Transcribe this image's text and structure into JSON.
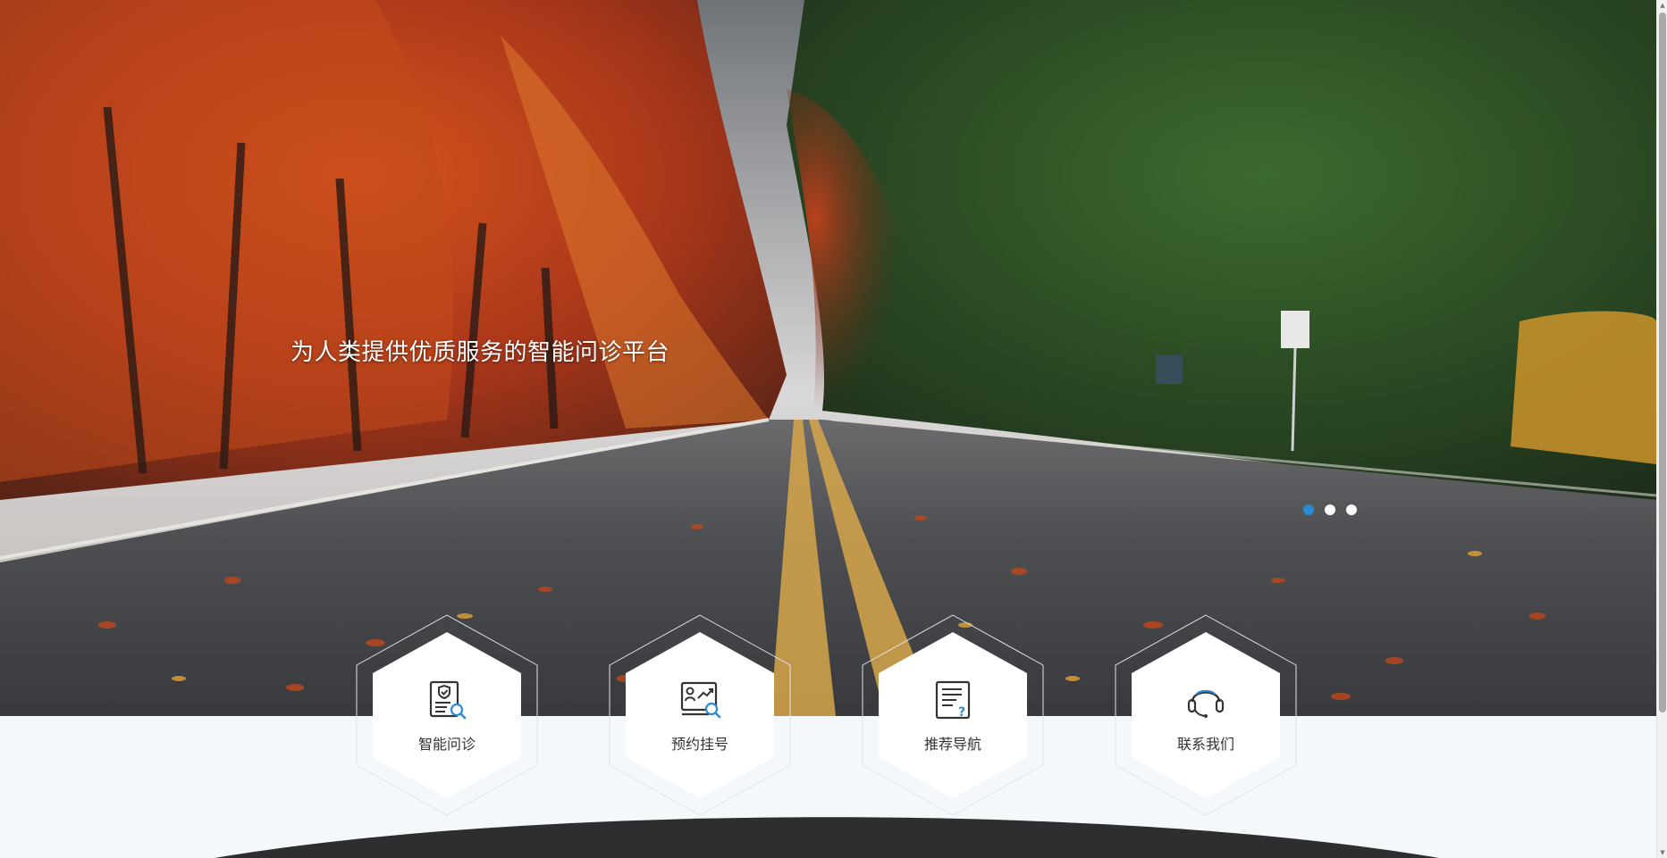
{
  "hero": {
    "title": "为人类提供优质服务的智能问诊平台",
    "carousel": {
      "slide_count": 3,
      "active_index": 0
    }
  },
  "features": [
    {
      "label": "智能问诊",
      "icon": "medical-report-search-icon"
    },
    {
      "label": "预约挂号",
      "icon": "appointment-monitor-search-icon"
    },
    {
      "label": "推荐导航",
      "icon": "document-question-icon"
    },
    {
      "label": "联系我们",
      "icon": "headset-icon"
    }
  ],
  "colors": {
    "accent": "#2b8bd2",
    "page_background": "#f5f8fb",
    "label_text": "#333333",
    "footer_dark": "#2e2e30"
  }
}
